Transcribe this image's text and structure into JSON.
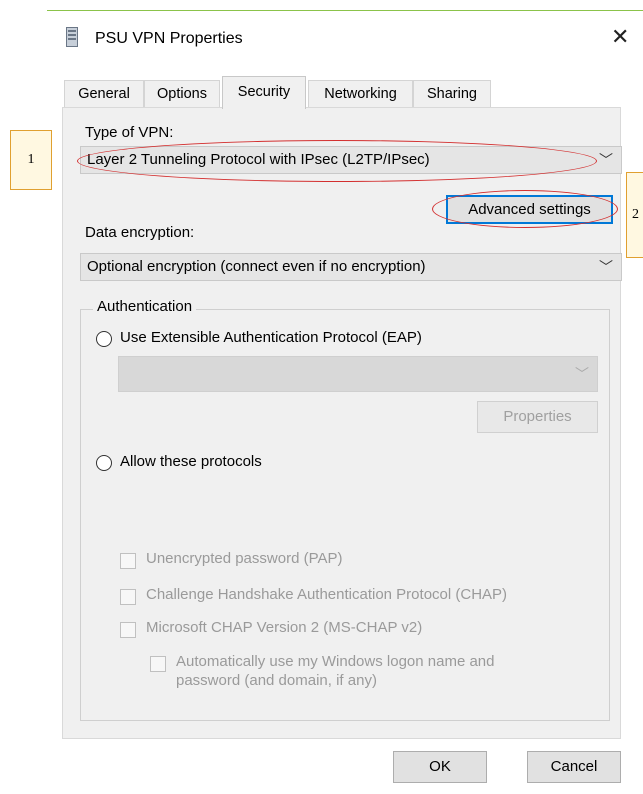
{
  "window": {
    "title": "PSU VPN Properties",
    "close_glyph": "✕"
  },
  "tabs": [
    {
      "label": "General"
    },
    {
      "label": "Options"
    },
    {
      "label": "Security",
      "active": true
    },
    {
      "label": "Networking"
    },
    {
      "label": "Sharing"
    }
  ],
  "security": {
    "vpn_type_label": "Type of VPN:",
    "vpn_type_value": "Layer 2 Tunneling Protocol with IPsec (L2TP/IPsec)",
    "advanced_settings": "Advanced settings",
    "data_encryption_label": "Data encryption:",
    "data_encryption_value": "Optional encryption (connect even if no encryption)",
    "authentication": {
      "legend": "Authentication",
      "use_eap": "Use Extensible Authentication Protocol (EAP)",
      "eap_value": "",
      "properties": "Properties",
      "allow_protocols": "Allow these protocols",
      "pap": "Unencrypted password (PAP)",
      "chap": "Challenge Handshake Authentication Protocol (CHAP)",
      "mschap": "Microsoft CHAP Version 2 (MS-CHAP v2)",
      "auto_logon_line1": "Automatically use my Windows logon name and",
      "auto_logon_line2": "password (and domain, if any)"
    }
  },
  "footer": {
    "ok": "OK",
    "cancel": "Cancel"
  },
  "annotations": {
    "a1": "1",
    "a2": "2"
  },
  "colors": {
    "annotation_ring": "#d32f2f",
    "focus": "#0078d7"
  }
}
